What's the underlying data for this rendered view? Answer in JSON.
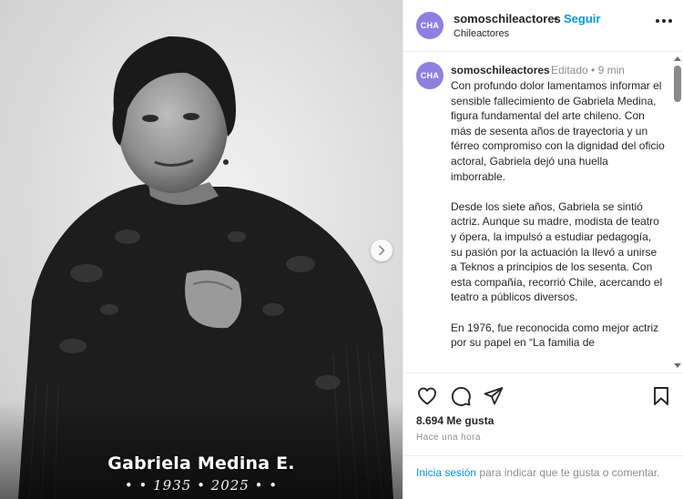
{
  "media": {
    "caption_name": "Gabriela Medina E.",
    "caption_years": "• • 1935 • 2025 • •",
    "next_icon": "chevron-right-icon"
  },
  "header": {
    "avatar_text": "CHA",
    "username": "somoschileactores",
    "separator": "•",
    "follow_label": "Seguir",
    "subtitle": "Chileactores",
    "more_icon": "more-horizontal-icon"
  },
  "caption": {
    "avatar_text": "CHA",
    "username": "somoschileactores",
    "meta": "Editado • 9 min",
    "paragraphs": [
      "Con profundo dolor lamentamos informar el sensible fallecimiento de Gabriela Medina, figura fundamental del arte chileno. Con más de sesenta años de trayectoria y un férreo compromiso con la dignidad del oficio actoral, Gabriela dejó una huella imborrable.",
      "Desde los siete años, Gabriela se sintió actriz. Aunque su madre, modista de teatro y ópera, la impulsó a estudiar pedagogía, su pasión por la actuación la llevó a unirse a Teknos a principios de los sesenta. Con esta compañía, recorrió Chile, acercando el teatro a públicos diversos.",
      "En 1976, fue reconocida como mejor actriz por su papel en “La familia de"
    ]
  },
  "actions": {
    "icons": [
      "heart-icon",
      "comment-icon",
      "share-icon",
      "bookmark-icon"
    ],
    "likes": "8.694 Me gusta",
    "time": "Hace una hora"
  },
  "login": {
    "link": "Inicia sesión",
    "text": " para indicar que te gusta o comentar."
  },
  "colors": {
    "accent": "#0095f6",
    "avatar_bg": "#8f7fe0",
    "muted": "#8e8e8e"
  }
}
